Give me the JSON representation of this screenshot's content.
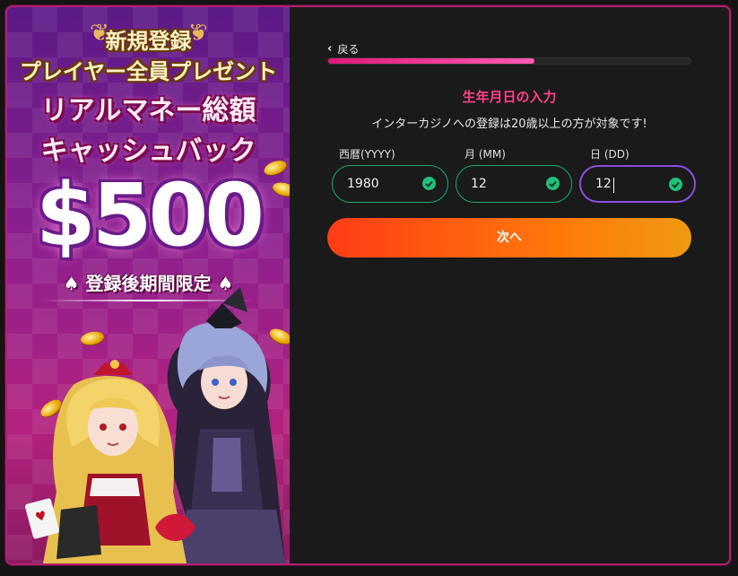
{
  "banner": {
    "heading1": "新規登録",
    "heading2": "プレイヤー全員プレゼント",
    "headline1": "リアルマネー総額",
    "headline2": "キャッシュバック",
    "amount": "$500",
    "limited": "登録後期間限定"
  },
  "form": {
    "back_label": "戻る",
    "progress": 0.57,
    "title": "生年月日の入力",
    "subtitle": "インターカジノへの登録は20歳以上の方が対象です!",
    "fields": [
      {
        "label": "西暦(YYYY)",
        "value": "1980"
      },
      {
        "label": "月 (MM)",
        "value": "12"
      },
      {
        "label": "日 (DD)",
        "value": "12"
      }
    ],
    "next_label": "次へ"
  },
  "colors": {
    "accent_pink": "#ff3f8a",
    "valid_green": "#21c07a",
    "active_purple": "#8a4de0",
    "button_orange": "#ff5a10"
  },
  "icons": [
    "chevron-left-icon",
    "check-circle-icon",
    "laurel-icon",
    "spade-icon",
    "coin-icon"
  ]
}
